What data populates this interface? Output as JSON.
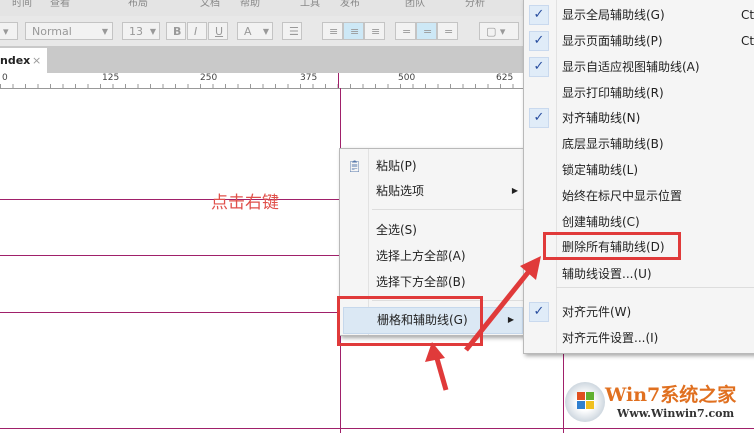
{
  "menubar": {
    "items": [
      "时间",
      "查看",
      "布局",
      "文档",
      "帮助",
      "工具",
      "发布",
      "团队",
      "分析"
    ]
  },
  "toolbar": {
    "style_value": "Normal",
    "font_size": "13",
    "bold": "B",
    "italic": "I",
    "underline": "U",
    "font_color": "A"
  },
  "tab": {
    "label": "ndex",
    "close": "×"
  },
  "ruler": {
    "labels": [
      "0",
      "125",
      "250",
      "375",
      "500",
      "625"
    ]
  },
  "annotation": "点击右键",
  "context_menu": {
    "items": [
      {
        "label": "粘贴(P)"
      },
      {
        "label": "粘贴选项"
      },
      {
        "label": "全选(S)"
      },
      {
        "label": "选择上方全部(A)"
      },
      {
        "label": "选择下方全部(B)"
      },
      {
        "label": "栅格和辅助线(G)"
      }
    ]
  },
  "submenu": {
    "items": [
      {
        "label": "显示全局辅助线(G)",
        "checked": true,
        "shortcut": "Ct"
      },
      {
        "label": "显示页面辅助线(P)",
        "checked": true,
        "shortcut": "Ct"
      },
      {
        "label": "显示自适应视图辅助线(A)",
        "checked": true
      },
      {
        "label": "显示打印辅助线(R)",
        "checked": false
      },
      {
        "label": "对齐辅助线(N)",
        "checked": true
      },
      {
        "label": "底层显示辅助线(B)",
        "checked": false
      },
      {
        "label": "锁定辅助线(L)",
        "checked": false
      },
      {
        "label": "始终在标尺中显示位置",
        "checked": false
      },
      {
        "label": "创建辅助线(C)",
        "checked": false
      },
      {
        "label": "删除所有辅助线(D)",
        "checked": false
      },
      {
        "label": "辅助线设置...(U)",
        "checked": false
      },
      {
        "label": "对齐元件(W)",
        "checked": true
      },
      {
        "label": "对齐元件设置...(I)",
        "checked": false
      }
    ]
  },
  "watermark": {
    "brand": "Win7系统之家",
    "url": "Www.Winwin7.com"
  },
  "colors": {
    "guide": "#a0206a",
    "highlight": "#e03a3a",
    "check": "#2a4fa0"
  }
}
